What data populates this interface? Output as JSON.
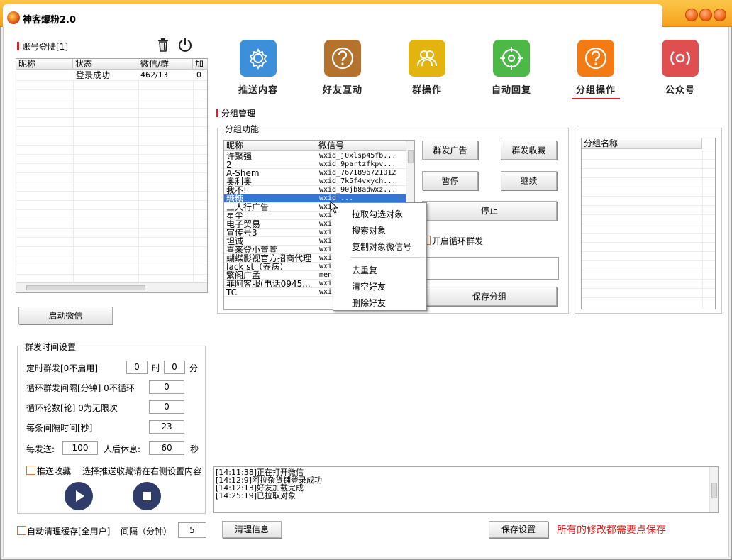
{
  "app": {
    "title": "神客爆粉2.0"
  },
  "account": {
    "header": "账号登陆[1]",
    "columns": [
      "昵称",
      "状态",
      "微信/群",
      "加"
    ],
    "rows": [
      {
        "nick": "",
        "status": "登录成功",
        "count": "462/13",
        "add": "0"
      }
    ]
  },
  "launch_button": "启动微信",
  "toolbar": {
    "items": [
      {
        "label": "推送内容",
        "icon": "gear-icon",
        "color": "#3d8fd9"
      },
      {
        "label": "好友互动",
        "icon": "question-icon",
        "color": "#b4722c"
      },
      {
        "label": "群操作",
        "icon": "group-icon",
        "color": "#e3b40e"
      },
      {
        "label": "自动回复",
        "icon": "target-icon",
        "color": "#4cb845"
      },
      {
        "label": "分组操作",
        "icon": "question-icon",
        "color": "#f47a14"
      },
      {
        "label": "公众号",
        "icon": "broadcast-icon",
        "color": "#e04f4f"
      }
    ]
  },
  "group_mgmt": {
    "title": "分组管理",
    "box_label": "分组功能",
    "columns": [
      "昵称",
      "微信号"
    ],
    "contacts": [
      {
        "nick": "许聚强",
        "wxid": "wxid_j0xlsp45fb..."
      },
      {
        "nick": "2",
        "wxid": "wxid_9partzfkpv..."
      },
      {
        "nick": "A-Shem",
        "wxid": "wxid_7671896721012"
      },
      {
        "nick": "奥利奥",
        "wxid": "wxid_7k5f4vxych..."
      },
      {
        "nick": "我不!",
        "wxid": "wxid_90jb8adwxz..."
      },
      {
        "nick": "糖糖",
        "wxid": "wxid_..."
      },
      {
        "nick": "三人行广告",
        "wxid": "wxi"
      },
      {
        "nick": "星尘",
        "wxid": "wxi"
      },
      {
        "nick": "电子贸易",
        "wxid": "wxi"
      },
      {
        "nick": "宣传号3",
        "wxid": "wxi"
      },
      {
        "nick": "坦诚",
        "wxid": "wxi"
      },
      {
        "nick": "喜来登小萱萱",
        "wxid": "wxi"
      },
      {
        "nick": "蝴蝶影视官方招商代理",
        "wxid": "wxi"
      },
      {
        "nick": "Jack st（养病）",
        "wxid": "wxi"
      },
      {
        "nick": "繁阁广孟",
        "wxid": "men"
      },
      {
        "nick": "菲阿客服(电话0945...",
        "wxid": "wxi"
      },
      {
        "nick": "TC",
        "wxid": "wxi"
      }
    ],
    "buttons": {
      "group_ad": "群发广告",
      "group_fav": "群发收藏",
      "pause": "暂停",
      "resume": "继续",
      "stop": "停止",
      "save_group": "保存分组"
    },
    "loop_checkbox": "开启循环群发",
    "group_name_header": "分组名称"
  },
  "context_menu": {
    "items": [
      "拉取勾选对象",
      "搜索对象",
      "复制对象微信号",
      "去重复",
      "清空好友",
      "删除好友"
    ]
  },
  "schedule": {
    "title": "群发时间设置",
    "timed_label": "定时群发[0不启用]",
    "hour_value": "0",
    "hour_unit": "时",
    "minute_value": "0",
    "minute_unit": "分",
    "interval_label": "循环群发间隔[分钟] 0不循环",
    "interval_value": "0",
    "rounds_label": "循环轮数[轮] 0为无限次",
    "rounds_value": "0",
    "each_label": "每条间隔时间[秒]",
    "each_value": "23",
    "per_send_label": "每发送:",
    "per_send_value": "100",
    "rest_label": "人后休息:",
    "rest_value": "60",
    "rest_unit": "秒",
    "push_fav_label": "推送收藏",
    "push_fav_hint": "选择推送收藏请在右侧设置内容"
  },
  "log": {
    "lines": [
      "[14:11:38]正在打开微信",
      "[14:12:9]阿拉杂货铺登录成功",
      "[14:12:13]好友加载完成",
      "[14:25:19]已拉取对象"
    ]
  },
  "footer": {
    "auto_clean_label": "自动清理缓存[全用户]",
    "interval_label": "间隔（分钟）",
    "interval_value": "5",
    "clear_button": "清理信息",
    "save_settings_button": "保存设置",
    "notice": "所有的修改都需要点保存",
    "notice_color": "#e0201a"
  }
}
